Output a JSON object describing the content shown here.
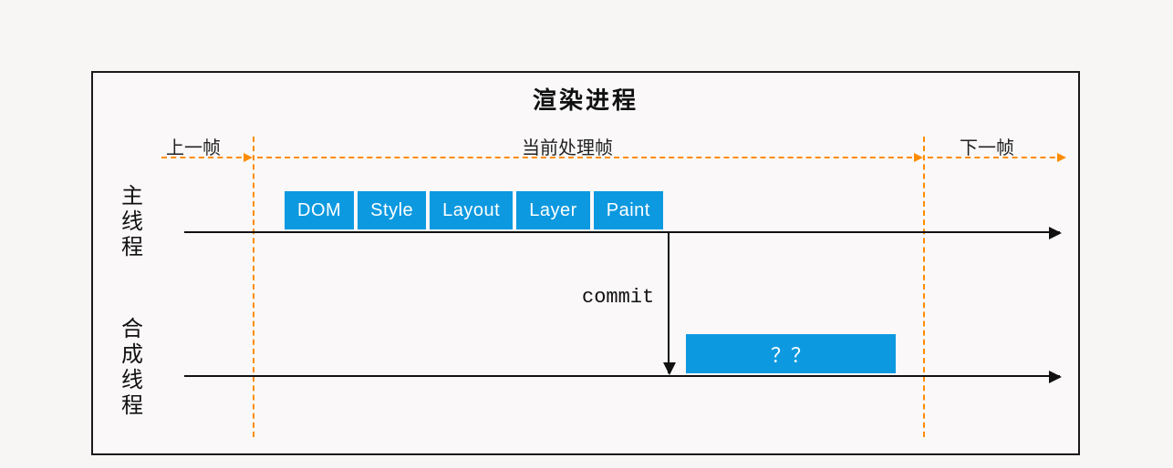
{
  "diagram": {
    "title": "渲染进程",
    "frames": {
      "prev": "上一帧",
      "current": "当前处理帧",
      "next": "下一帧"
    },
    "threads": {
      "main": "主线程",
      "compositor": "合成线程"
    },
    "pipeline_stages": [
      "DOM",
      "Style",
      "Layout",
      "Layer",
      "Paint"
    ],
    "commit_label": "commit",
    "compositor_task": "？？",
    "colors": {
      "stage_bg": "#0d99e0",
      "dashed": "#ff8c00",
      "line": "#111111"
    }
  }
}
